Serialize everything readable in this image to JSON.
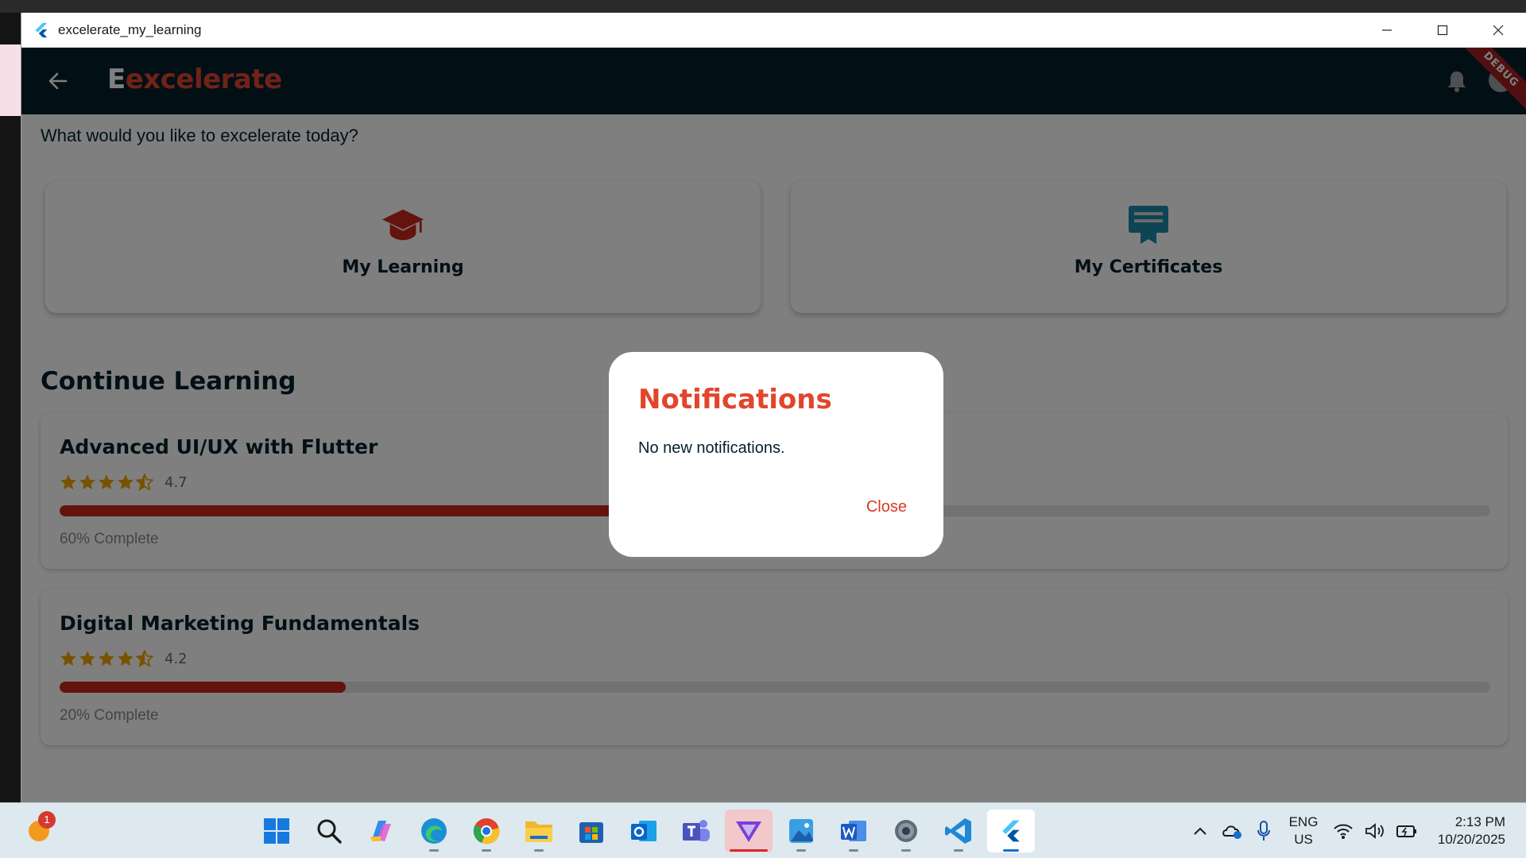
{
  "window": {
    "title": "excelerate_my_learning"
  },
  "appbar": {
    "brand_first": "E",
    "brand_rest": "excelerate",
    "debug_label": "DEBUG"
  },
  "home": {
    "greeting": "What would you like to excelerate today?",
    "quick_actions": [
      {
        "label": "My Learning",
        "icon": "graduation-cap-icon",
        "color": "#c9281b"
      },
      {
        "label": "My Certificates",
        "icon": "certificate-icon",
        "color": "#1a8aa8"
      }
    ],
    "section_title": "Continue Learning"
  },
  "courses": [
    {
      "title": "Advanced UI/UX with Flutter",
      "stars": 4.5,
      "rating": "4.7",
      "progress": 0.6,
      "progress_label": "60% Complete"
    },
    {
      "title": "Digital Marketing Fundamentals",
      "stars": 4.5,
      "rating": "4.2",
      "progress": 0.2,
      "progress_label": "20% Complete"
    }
  ],
  "dialog": {
    "title": "Notifications",
    "body": "No new notifications.",
    "close_label": "Close"
  },
  "taskbar": {
    "notification_count": "1",
    "apps": [
      "start-icon",
      "search-icon",
      "copilot-icon",
      "edge-icon",
      "chrome-icon",
      "file-explorer-icon",
      "store-icon",
      "outlook-icon",
      "teams-icon",
      "vpn-icon",
      "photos-icon",
      "word-icon",
      "settings-icon",
      "vscode-icon",
      "flutter-icon"
    ],
    "lang_line1": "ENG",
    "lang_line2": "US",
    "time": "2:13 PM",
    "date": "10/20/2025"
  },
  "colors": {
    "appbar": "#04212c",
    "accent": "#e2452c",
    "progress": "#c9281b",
    "star": "#f0a500"
  }
}
